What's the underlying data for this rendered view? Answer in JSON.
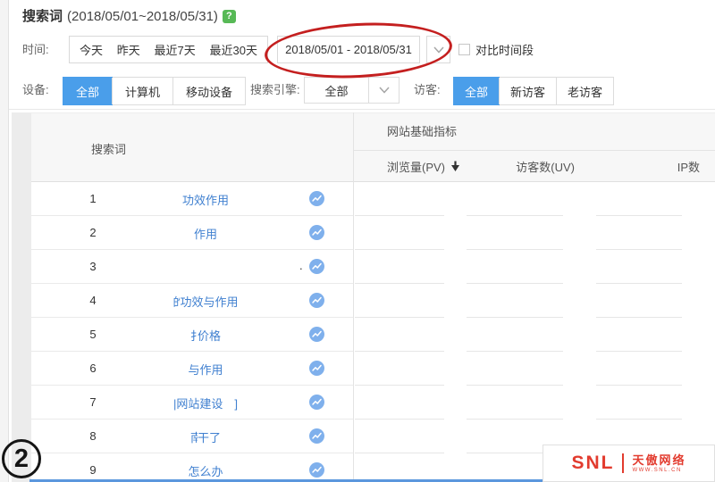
{
  "header": {
    "title": "搜索词",
    "date_range": "(2018/05/01~2018/05/31)",
    "help_icon": "?"
  },
  "filters": {
    "time_label": "时间:",
    "time_quick": [
      "今天",
      "昨天",
      "最近7天",
      "最近30天"
    ],
    "date_value": "2018/05/01 - 2018/05/31",
    "compare_label": "对比时间段",
    "device_label": "设备:",
    "device_options": [
      "全部",
      "计算机",
      "移动设备"
    ],
    "device_selected": "全部",
    "engine_label": "搜索引擎:",
    "engine_value": "全部",
    "visitor_label": "访客:",
    "visitor_options": [
      "全部",
      "新访客",
      "老访客"
    ],
    "visitor_selected": "全部"
  },
  "table": {
    "keyword_header": "搜索词",
    "group_header": "网站基础指标",
    "metrics": [
      "浏览量(PV)",
      "访客数(UV)",
      "IP数"
    ],
    "rows": [
      {
        "num": "1",
        "partial": "",
        "keyword": "功效作用",
        "dot": ""
      },
      {
        "num": "2",
        "partial": "",
        "keyword": "作用",
        "dot": ""
      },
      {
        "num": "3",
        "partial": "",
        "keyword": "",
        "dot": "."
      },
      {
        "num": "4",
        "partial": "的",
        "keyword": "功效与作用",
        "dot": ""
      },
      {
        "num": "5",
        "partial": "扌",
        "keyword": "价格",
        "dot": ""
      },
      {
        "num": "6",
        "partial": "",
        "keyword": "与作用",
        "dot": ""
      },
      {
        "num": "7",
        "partial": "",
        "keyword": "|网站建设　]",
        "dot": ""
      },
      {
        "num": "8",
        "partial": "南",
        "keyword": "干了",
        "dot": ""
      },
      {
        "num": "9",
        "partial": "",
        "keyword": "怎么办",
        "dot": ""
      }
    ]
  },
  "annotation": {
    "step": "2"
  },
  "watermark": {
    "brand": "SNL",
    "name": "天傲网络",
    "url": "WWW.SNL.CN"
  },
  "icons": {
    "help": "question-badge",
    "date_caret": "chevron-down",
    "engine_caret": "chevron-down",
    "sort": "arrow-down-solid",
    "trend": "trend-line-circle"
  },
  "colors": {
    "accent_blue": "#4a9eea",
    "link_blue": "#4080d0",
    "help_green": "#57b956",
    "annotation_red": "#c41f1f",
    "logo_red": "#e23b2e",
    "bottom_bar_blue": "#5b97dd"
  }
}
